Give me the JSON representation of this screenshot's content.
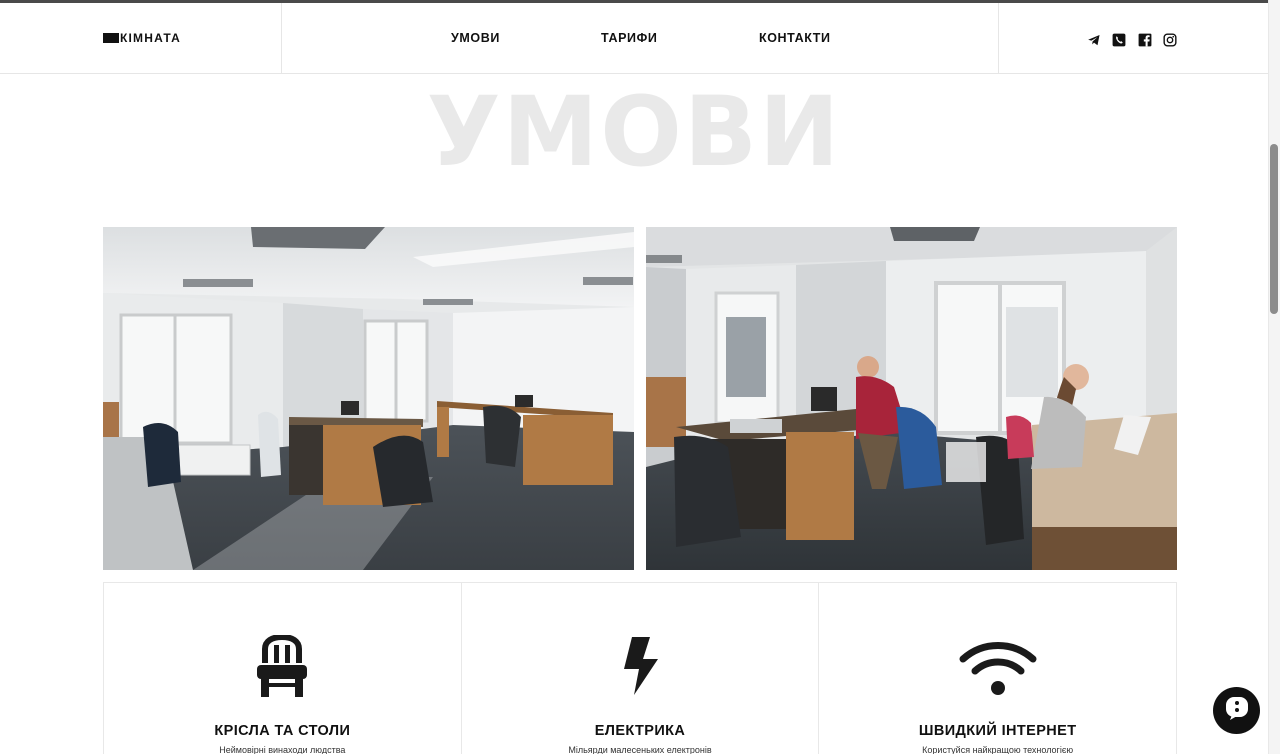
{
  "header": {
    "logo_text": "КІМНАТА",
    "nav": [
      {
        "label": "УМОВИ"
      },
      {
        "label": "ТАРИФИ"
      },
      {
        "label": "КОНТАКТИ"
      }
    ],
    "social_icons": [
      "telegram-icon",
      "phone-icon",
      "facebook-icon",
      "instagram-icon"
    ]
  },
  "section": {
    "title": "УМОВИ"
  },
  "features": [
    {
      "icon": "chair-icon",
      "title": "КРІСЛА ТА СТОЛИ",
      "desc": "Неймовірні винаходи людства"
    },
    {
      "icon": "lightning-icon",
      "title": "ЕЛЕКТРИКА",
      "desc": "Мільярди малесеньких електронів"
    },
    {
      "icon": "wifi-icon",
      "title": "ШВИДКИЙ ІНТЕРНЕТ",
      "desc": "Користуйся найкращою технологією"
    }
  ],
  "colors": {
    "text": "#111111",
    "title_watermark": "#e9e9e9",
    "border": "#e8e8e8"
  }
}
